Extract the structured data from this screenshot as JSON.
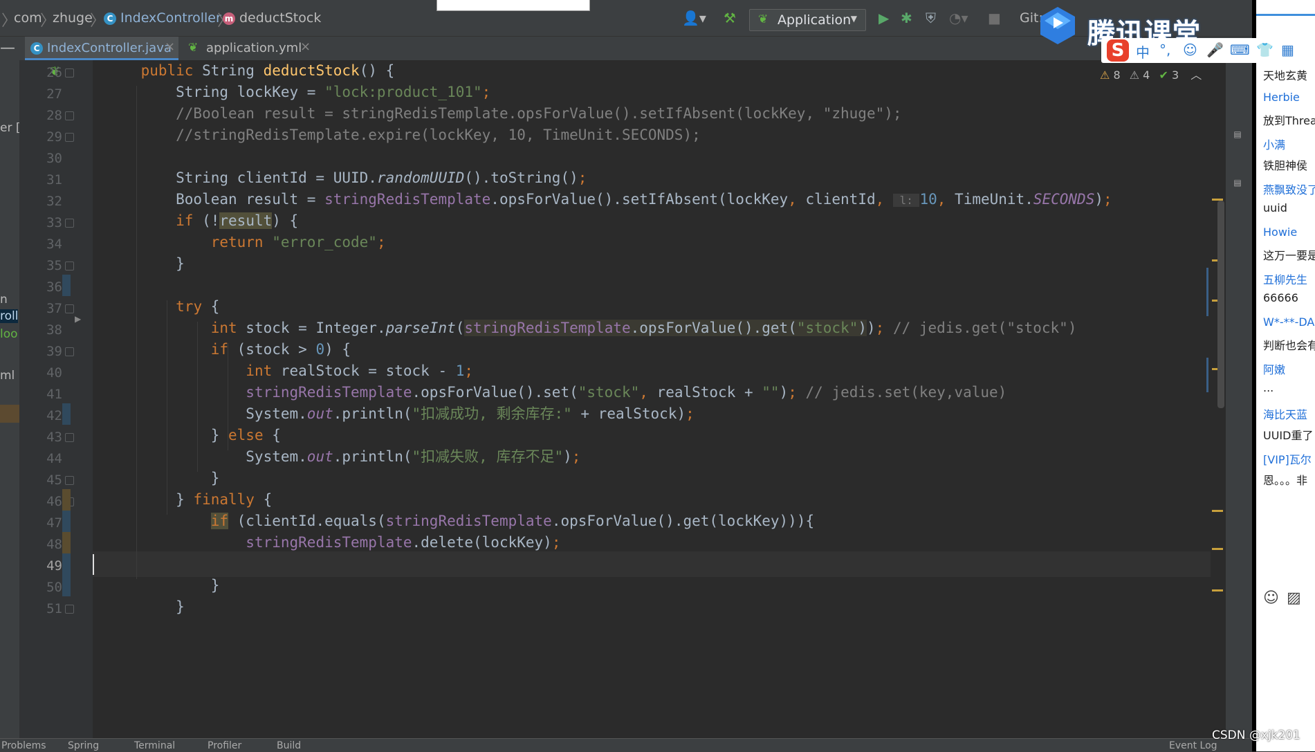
{
  "breadcrumb": {
    "items": [
      "com",
      "zhuge",
      "IndexController",
      "deductStock"
    ],
    "class_badge": "C",
    "method_badge": "m"
  },
  "toolbar": {
    "run_config": "Application",
    "git_label": "Git:"
  },
  "tabs": [
    {
      "label": "IndexController.java",
      "icon": "C",
      "active": true
    },
    {
      "label": "application.yml",
      "icon": "",
      "active": false
    }
  ],
  "project_fragments": [
    "er [r",
    "n",
    "roll",
    "loo",
    "ml"
  ],
  "inspections": {
    "warnings": "8",
    "weak_warnings": "4",
    "ok": "3"
  },
  "colors": {
    "keyword": "#cc7832",
    "string": "#6a8759",
    "number": "#6897bb",
    "comment": "#808080",
    "field": "#9876aa",
    "method_decl": "#ffc66d",
    "plain": "#a9b7c6",
    "accent": "#4a88c7"
  },
  "editor": {
    "current_line": 49,
    "lines": [
      {
        "n": "26",
        "tokens": [
          {
            "t": "    ",
            "c": "plain"
          },
          {
            "t": "public ",
            "c": "keyword"
          },
          {
            "t": "String ",
            "c": "plain"
          },
          {
            "t": "deductStock",
            "c": "method_decl"
          },
          {
            "t": "() {",
            "c": "plain"
          }
        ]
      },
      {
        "n": "27",
        "tokens": [
          {
            "t": "        String lockKey = ",
            "c": "plain"
          },
          {
            "t": "\"lock:product_101\"",
            "c": "string"
          },
          {
            "t": ";",
            "c": "keyword"
          }
        ]
      },
      {
        "n": "28",
        "tokens": [
          {
            "t": "        //Boolean result = stringRedisTemplate.opsForValue().setIfAbsent(lockKey, \"zhuge\");",
            "c": "comment"
          }
        ]
      },
      {
        "n": "29",
        "tokens": [
          {
            "t": "        //stringRedisTemplate.expire(lockKey, 10, TimeUnit.SECONDS);",
            "c": "comment"
          }
        ]
      },
      {
        "n": "30",
        "tokens": []
      },
      {
        "n": "31",
        "tokens": [
          {
            "t": "        String clientId = UUID.",
            "c": "plain"
          },
          {
            "t": "randomUUID",
            "c": "italic"
          },
          {
            "t": "().toString()",
            "c": "plain"
          },
          {
            "t": ";",
            "c": "keyword"
          }
        ]
      },
      {
        "n": "32",
        "tokens": [
          {
            "t": "        Boolean result = ",
            "c": "plain"
          },
          {
            "t": "stringRedisTemplate",
            "c": "field"
          },
          {
            "t": ".opsForValue().setIfAbsent(lockKey",
            "c": "plain"
          },
          {
            "t": ", ",
            "c": "keyword"
          },
          {
            "t": "clientId",
            "c": "plain"
          },
          {
            "t": ", ",
            "c": "keyword"
          },
          {
            "t": " l: ",
            "c": "hint"
          },
          {
            "t": "10",
            "c": "number"
          },
          {
            "t": ", ",
            "c": "keyword"
          },
          {
            "t": "TimeUnit.",
            "c": "plain"
          },
          {
            "t": "SECONDS",
            "c": "field_italic"
          },
          {
            "t": ")",
            "c": "plain"
          },
          {
            "t": ";",
            "c": "keyword"
          }
        ]
      },
      {
        "n": "33",
        "tokens": [
          {
            "t": "        ",
            "c": "plain"
          },
          {
            "t": "if ",
            "c": "keyword"
          },
          {
            "t": "(!",
            "c": "plain"
          },
          {
            "t": "result",
            "c": "highlight"
          },
          {
            "t": ") {",
            "c": "plain"
          }
        ]
      },
      {
        "n": "34",
        "tokens": [
          {
            "t": "            ",
            "c": "plain"
          },
          {
            "t": "return ",
            "c": "keyword"
          },
          {
            "t": "\"error_code\"",
            "c": "string"
          },
          {
            "t": ";",
            "c": "keyword"
          }
        ]
      },
      {
        "n": "35",
        "tokens": [
          {
            "t": "        }",
            "c": "plain"
          }
        ]
      },
      {
        "n": "36",
        "tokens": []
      },
      {
        "n": "37",
        "tokens": [
          {
            "t": "        ",
            "c": "plain"
          },
          {
            "t": "try ",
            "c": "keyword"
          },
          {
            "t": "{",
            "c": "plain"
          }
        ]
      },
      {
        "n": "38",
        "tokens": [
          {
            "t": "            ",
            "c": "plain"
          },
          {
            "t": "int ",
            "c": "keyword"
          },
          {
            "t": "stock = Integer.",
            "c": "plain"
          },
          {
            "t": "parseInt",
            "c": "italic"
          },
          {
            "t": "(",
            "c": "plain"
          },
          {
            "t": "stringRedisTemplate",
            "c": "field_hl"
          },
          {
            "t": ".opsForValue().get(",
            "c": "plain_hl"
          },
          {
            "t": "\"stock\"",
            "c": "string_hl"
          },
          {
            "t": ")",
            "c": "plain_hl"
          },
          {
            "t": ")",
            "c": "plain"
          },
          {
            "t": "; ",
            "c": "keyword"
          },
          {
            "t": "// jedis.get(\"stock\")",
            "c": "comment"
          }
        ]
      },
      {
        "n": "39",
        "tokens": [
          {
            "t": "            ",
            "c": "plain"
          },
          {
            "t": "if ",
            "c": "keyword"
          },
          {
            "t": "(stock > ",
            "c": "plain"
          },
          {
            "t": "0",
            "c": "number"
          },
          {
            "t": ") {",
            "c": "plain"
          }
        ]
      },
      {
        "n": "40",
        "tokens": [
          {
            "t": "                ",
            "c": "plain"
          },
          {
            "t": "int ",
            "c": "keyword"
          },
          {
            "t": "realStock = stock - ",
            "c": "plain"
          },
          {
            "t": "1",
            "c": "number"
          },
          {
            "t": ";",
            "c": "keyword"
          }
        ]
      },
      {
        "n": "41",
        "tokens": [
          {
            "t": "                ",
            "c": "plain"
          },
          {
            "t": "stringRedisTemplate",
            "c": "field"
          },
          {
            "t": ".opsForValue().set(",
            "c": "plain"
          },
          {
            "t": "\"stock\"",
            "c": "string"
          },
          {
            "t": ", ",
            "c": "keyword"
          },
          {
            "t": "realStock + ",
            "c": "plain"
          },
          {
            "t": "\"\"",
            "c": "string"
          },
          {
            "t": ")",
            "c": "plain"
          },
          {
            "t": "; ",
            "c": "keyword"
          },
          {
            "t": "// jedis.set(key,value)",
            "c": "comment"
          }
        ]
      },
      {
        "n": "42",
        "tokens": [
          {
            "t": "                System.",
            "c": "plain"
          },
          {
            "t": "out",
            "c": "field_italic"
          },
          {
            "t": ".println(",
            "c": "plain"
          },
          {
            "t": "\"扣减成功, 剩余库存:\"",
            "c": "string"
          },
          {
            "t": " + realStock)",
            "c": "plain"
          },
          {
            "t": ";",
            "c": "keyword"
          }
        ]
      },
      {
        "n": "43",
        "tokens": [
          {
            "t": "            } ",
            "c": "plain"
          },
          {
            "t": "else ",
            "c": "keyword"
          },
          {
            "t": "{",
            "c": "plain"
          }
        ]
      },
      {
        "n": "44",
        "tokens": [
          {
            "t": "                System.",
            "c": "plain"
          },
          {
            "t": "out",
            "c": "field_italic"
          },
          {
            "t": ".println(",
            "c": "plain"
          },
          {
            "t": "\"扣减失败, 库存不足\"",
            "c": "string"
          },
          {
            "t": ")",
            "c": "plain"
          },
          {
            "t": ";",
            "c": "keyword"
          }
        ]
      },
      {
        "n": "45",
        "tokens": [
          {
            "t": "            }",
            "c": "plain"
          }
        ]
      },
      {
        "n": "46",
        "tokens": [
          {
            "t": "        } ",
            "c": "plain"
          },
          {
            "t": "finally ",
            "c": "keyword"
          },
          {
            "t": "{",
            "c": "plain"
          }
        ]
      },
      {
        "n": "47",
        "tokens": [
          {
            "t": "            ",
            "c": "plain"
          },
          {
            "t": "if",
            "c": "keyword_hl"
          },
          {
            "t": " (clientId.equals(",
            "c": "plain"
          },
          {
            "t": "stringRedisTemplate",
            "c": "field"
          },
          {
            "t": ".opsForValue().get(lockKey))){",
            "c": "plain"
          }
        ]
      },
      {
        "n": "48",
        "tokens": [
          {
            "t": "                ",
            "c": "plain"
          },
          {
            "t": "stringRedisTemplate",
            "c": "field"
          },
          {
            "t": ".delete(lockKey)",
            "c": "plain"
          },
          {
            "t": ";",
            "c": "keyword"
          }
        ]
      },
      {
        "n": "49",
        "tokens": []
      },
      {
        "n": "50",
        "tokens": [
          {
            "t": "            }",
            "c": "plain"
          }
        ]
      },
      {
        "n": "51",
        "tokens": [
          {
            "t": "        }",
            "c": "plain"
          }
        ]
      }
    ]
  },
  "bottom_bar": [
    "Problems",
    "Spring",
    "Terminal",
    "Profiler",
    "Build",
    "Event Log"
  ],
  "chat": {
    "messages": [
      {
        "name": "",
        "text": "天地玄黄"
      },
      {
        "name": "Herbie",
        "text": "放到Threa"
      },
      {
        "name": "小满",
        "text": "铁胆神侯"
      },
      {
        "name": "燕飘致没了",
        "text": "uuid"
      },
      {
        "name": "Howie",
        "text": "这万一要是"
      },
      {
        "name": "五柳先生",
        "text": "66666"
      },
      {
        "name": "W*-**-DA",
        "text": "判断也会有"
      },
      {
        "name": "阿嫩",
        "text": "..."
      },
      {
        "name": "海比天蓝",
        "text": "UUID重了"
      },
      {
        "name": "[VIP]瓦尔",
        "text": "恩。。。非"
      }
    ]
  },
  "overlay": {
    "brand": "腾讯课堂",
    "ime_items": [
      "中",
      "°,",
      "☺",
      "🎤",
      "⌨",
      "👕",
      "▦"
    ],
    "watermark": "CSDN @xjk201"
  }
}
